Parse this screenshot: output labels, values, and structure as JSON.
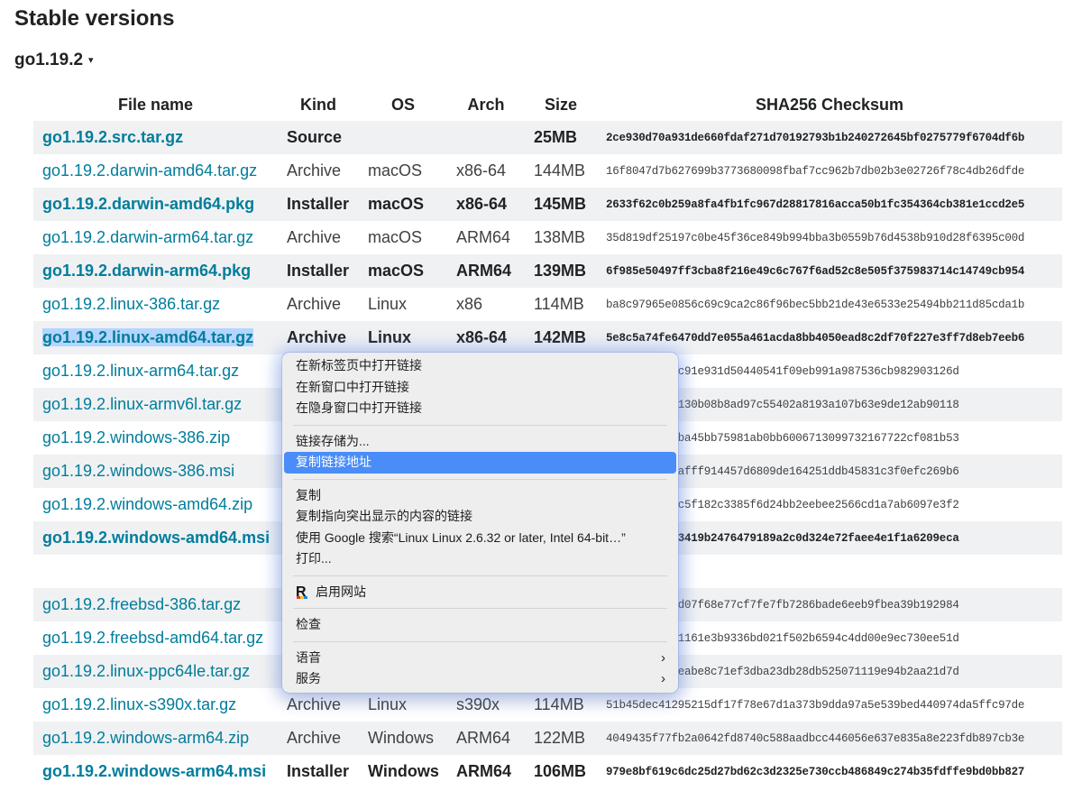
{
  "page": {
    "heading": "Stable versions",
    "version_label": "go1.19.2",
    "caret": "▾"
  },
  "table": {
    "headers": [
      "File name",
      "Kind",
      "OS",
      "Arch",
      "Size",
      "SHA256 Checksum"
    ],
    "rows": [
      {
        "name": "go1.19.2.src.tar.gz",
        "kind": "Source",
        "os": "",
        "arch": "",
        "size": "25MB",
        "sum": "2ce930d70a931de660fdaf271d70192793b1b240272645bf0275779f6704df6b",
        "highlight": true
      },
      {
        "name": "go1.19.2.darwin-amd64.tar.gz",
        "kind": "Archive",
        "os": "macOS",
        "arch": "x86-64",
        "size": "144MB",
        "sum": "16f8047d7b627699b3773680098fbaf7cc962b7db02b3e02726f78c4db26dfde"
      },
      {
        "name": "go1.19.2.darwin-amd64.pkg",
        "kind": "Installer",
        "os": "macOS",
        "arch": "x86-64",
        "size": "145MB",
        "sum": "2633f62c0b259a8fa4fb1fc967d28817816acca50b1fc354364cb381e1ccd2e5",
        "highlight": true
      },
      {
        "name": "go1.19.2.darwin-arm64.tar.gz",
        "kind": "Archive",
        "os": "macOS",
        "arch": "ARM64",
        "size": "138MB",
        "sum": "35d819df25197c0be45f36ce849b994bba3b0559b76d4538b910d28f6395c00d"
      },
      {
        "name": "go1.19.2.darwin-arm64.pkg",
        "kind": "Installer",
        "os": "macOS",
        "arch": "ARM64",
        "size": "139MB",
        "sum": "6f985e50497ff3cba8f216e49c6c767f6ad52c8e505f375983714c14749cb954",
        "highlight": true
      },
      {
        "name": "go1.19.2.linux-386.tar.gz",
        "kind": "Archive",
        "os": "Linux",
        "arch": "x86",
        "size": "114MB",
        "sum": "ba8c97965e0856c69c9ca2c86f96bec5bb21de43e6533e25494bb211d85cda1b"
      },
      {
        "name": "go1.19.2.linux-amd64.tar.gz",
        "kind": "Archive",
        "os": "Linux",
        "arch": "x86-64",
        "size": "142MB",
        "sum": "5e8c5a74fe6470dd7e055a461acda8bb4050ead8c2df70f227e3ff7d8eb7eeb6",
        "highlight": true,
        "selected": true
      },
      {
        "name": "go1.19.2.linux-arm64.tar.gz",
        "kind": "",
        "os": "",
        "arch": "",
        "size": "",
        "sum": "436c67c14a0c91e931d50440541f09eb991a987536cb982903126d"
      },
      {
        "name": "go1.19.2.linux-armv6l.tar.gz",
        "kind": "",
        "os": "",
        "arch": "",
        "size": "",
        "sum": "ecd704ebafd130b08b8ad97c55402a8193a107b63e9de12ab90118"
      },
      {
        "name": "go1.19.2.windows-386.zip",
        "kind": "",
        "os": "",
        "arch": "",
        "size": "",
        "sum": "e9db33945a7ba45bb75981ab0bb6006713099732167722cf081b53"
      },
      {
        "name": "go1.19.2.windows-386.msi",
        "kind": "",
        "os": "",
        "arch": "",
        "size": "",
        "sum": "74469353917afff914457d6809de164251ddb45831c3f0efc269b6"
      },
      {
        "name": "go1.19.2.windows-amd64.zip",
        "kind": "",
        "os": "",
        "arch": "",
        "size": "",
        "sum": "3b0d417eb6cc5f182c3385f6d24bb2eebee2566cd1a7ab6097e3f2"
      },
      {
        "name": "go1.19.2.windows-amd64.msi",
        "kind": "",
        "os": "",
        "arch": "",
        "size": "",
        "sum": "f30133deadb3419b2476479189a2c0d324e72faee4e1f1a6209eca",
        "highlight": true
      },
      {
        "name": "",
        "kind": "",
        "os": "",
        "arch": "",
        "size": "",
        "sum": "",
        "gap": true
      },
      {
        "name": "go1.19.2.freebsd-386.tar.gz",
        "kind": "",
        "os": "",
        "arch": "",
        "size": "",
        "sum": "7a14d964212d07f68e77cf7fe7fb7286bade6eeb9fbea39b192984"
      },
      {
        "name": "go1.19.2.freebsd-amd64.tar.gz",
        "kind": "",
        "os": "",
        "arch": "",
        "size": "",
        "sum": "34d14826ec21161e3b9336bd021f502b6594c4dd00e9ec730ee51d"
      },
      {
        "name": "go1.19.2.linux-ppc64le.tar.gz",
        "kind": "",
        "os": "",
        "arch": "",
        "size": "",
        "sum": "7103aeb9babeabe8c71ef3dba23db28db525071119e94b2aa21d7d"
      },
      {
        "name": "go1.19.2.linux-s390x.tar.gz",
        "kind": "Archive",
        "os": "Linux",
        "arch": "s390x",
        "size": "114MB",
        "sum": "51b45dec41295215df17f78e67d1a373b9dda97a5e539bed440974da5ffc97de"
      },
      {
        "name": "go1.19.2.windows-arm64.zip",
        "kind": "Archive",
        "os": "Windows",
        "arch": "ARM64",
        "size": "122MB",
        "sum": "4049435f77fb2a0642fd8740c588aadbcc446056e637e835a8e223fdb897cb3e"
      },
      {
        "name": "go1.19.2.windows-arm64.msi",
        "kind": "Installer",
        "os": "Windows",
        "arch": "ARM64",
        "size": "106MB",
        "sum": "979e8bf619c6dc25d27bd62c3d2325e730ccb486849c274b35fdffe9bd0bb827",
        "highlight": true
      }
    ]
  },
  "context_menu": {
    "items": [
      {
        "name": "open-in-new-tab",
        "label": "在新标签页中打开链接"
      },
      {
        "name": "open-in-new-window",
        "label": "在新窗口中打开链接"
      },
      {
        "name": "open-in-incognito",
        "label": "在隐身窗口中打开链接"
      },
      {
        "separator": true
      },
      {
        "name": "save-link-as",
        "label": "链接存储为..."
      },
      {
        "name": "copy-link-address",
        "label": "复制链接地址",
        "active": true
      },
      {
        "separator": true
      },
      {
        "name": "copy",
        "label": "复制"
      },
      {
        "name": "copy-link-to-highlight",
        "label": "复制指向突出显示的内容的链接"
      },
      {
        "name": "search-google",
        "label": "使用 Google 搜索“Linux Linux 2.6.32 or later, Intel 64-bit…”"
      },
      {
        "name": "print",
        "label": "打印..."
      },
      {
        "separator": true
      },
      {
        "name": "enable-site",
        "label": "启用网站",
        "icon": "extension-r-icon"
      },
      {
        "separator": true
      },
      {
        "name": "inspect",
        "label": "检查"
      },
      {
        "separator": true
      },
      {
        "name": "speech",
        "label": "语音",
        "submenu": true
      },
      {
        "name": "services",
        "label": "服务",
        "submenu": true
      }
    ],
    "submenu_arrow": "›"
  },
  "colors": {
    "link": "#007d9c",
    "stripe": "#f0f1f2",
    "selection": "#b4d5fe",
    "menu_active": "#4a8df8"
  }
}
